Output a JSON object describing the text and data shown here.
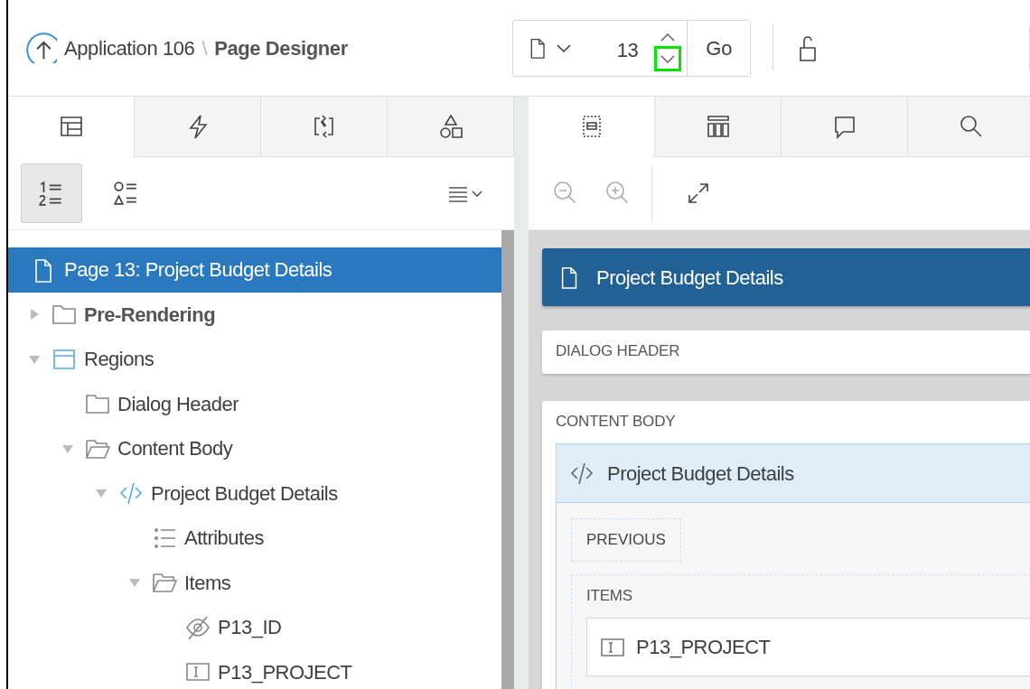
{
  "header": {
    "app_link": "Application 106",
    "separator": "\\",
    "title": "Page Designer",
    "page_selector": {
      "value": "13",
      "go": "Go",
      "down_highlighted": true
    }
  },
  "left_tabs": [
    {
      "kind": "rendering",
      "selected": true
    },
    {
      "kind": "dynamic-actions",
      "selected": false
    },
    {
      "kind": "processing",
      "selected": false
    },
    {
      "kind": "shared",
      "selected": false
    }
  ],
  "left_toolbar": [
    {
      "kind": "numbered-list",
      "selected": true
    },
    {
      "kind": "shape-list",
      "selected": false
    },
    {
      "kind": "menu",
      "selected": false
    }
  ],
  "tree": [
    {
      "label": "Page 13: Project Budget Details",
      "kind": "page",
      "selected": true,
      "bold": false
    },
    {
      "label": "Pre-Rendering",
      "kind": "folder",
      "selected": false,
      "bold": true,
      "expanded": false
    },
    {
      "label": "Regions",
      "kind": "regions",
      "selected": false,
      "bold": false,
      "expanded": true,
      "children": [
        {
          "label": "Dialog Header",
          "kind": "folder",
          "selected": false,
          "bold": false
        },
        {
          "label": "Content Body",
          "kind": "folder-open",
          "selected": false,
          "bold": false,
          "expanded": true,
          "children": [
            {
              "label": "Project Budget Details",
              "kind": "code",
              "selected": false,
              "bold": false,
              "expanded": true,
              "children": [
                {
                  "label": "Attributes",
                  "kind": "attributes",
                  "selected": false,
                  "bold": false
                },
                {
                  "label": "Items",
                  "kind": "folder-open",
                  "selected": false,
                  "bold": false,
                  "expanded": true,
                  "children": [
                    {
                      "label": "P13_ID",
                      "kind": "hidden",
                      "selected": false,
                      "bold": false
                    },
                    {
                      "label": "P13_PROJECT",
                      "kind": "text-field",
                      "selected": false,
                      "bold": false
                    }
                  ]
                }
              ]
            }
          ]
        }
      ]
    }
  ],
  "right_tabs": [
    {
      "kind": "layout",
      "selected": true
    },
    {
      "kind": "gallery",
      "selected": false
    },
    {
      "kind": "messages",
      "selected": false
    },
    {
      "kind": "search",
      "selected": false
    }
  ],
  "right_toolbar": [
    {
      "kind": "zoom-out"
    },
    {
      "kind": "zoom-in"
    },
    {
      "kind": "expand"
    }
  ],
  "canvas": {
    "page_title": "Project Budget Details",
    "sections": [
      {
        "label": "DIALOG HEADER"
      },
      {
        "label": "CONTENT BODY",
        "regions": [
          {
            "title": "Project Budget Details",
            "button_position": "PREVIOUS",
            "items_label": "ITEMS",
            "items": [
              {
                "label": "P13_PROJECT",
                "kind": "text-field"
              }
            ]
          }
        ]
      }
    ]
  }
}
